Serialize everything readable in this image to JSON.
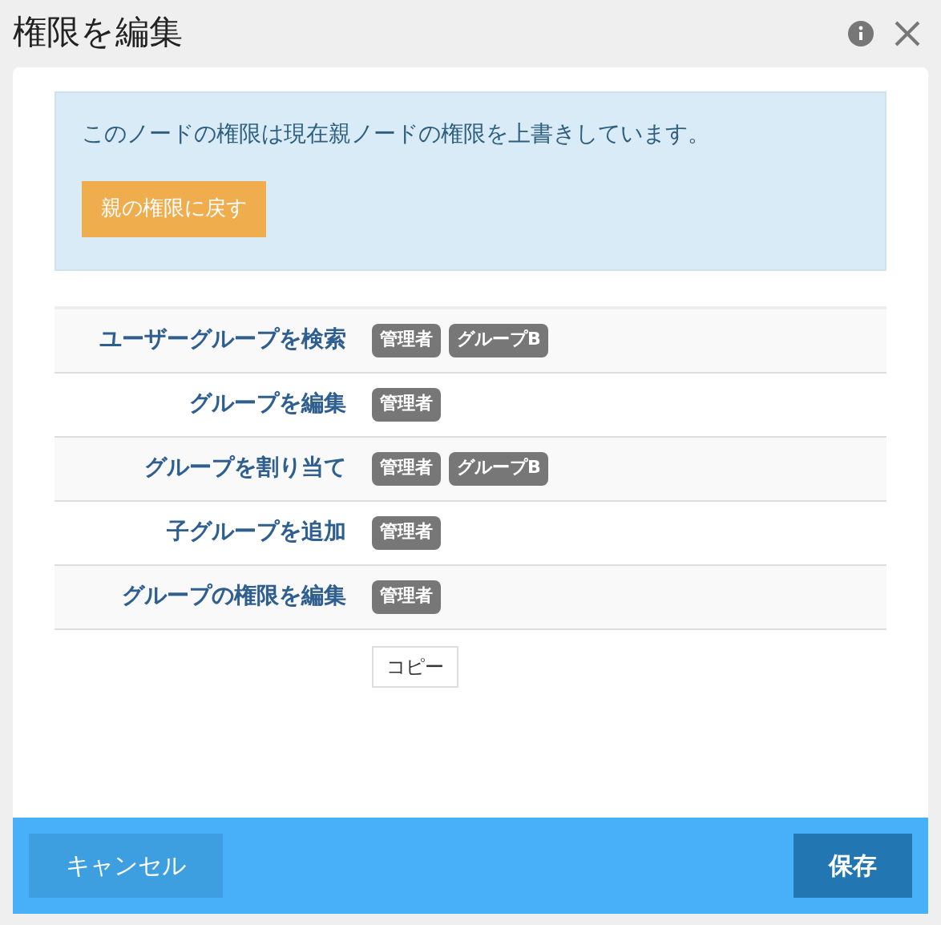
{
  "window": {
    "title": "権限を編集"
  },
  "notice": {
    "message": "このノードの権限は現在親ノードの権限を上書きしています。",
    "button": "親の権限に戻す"
  },
  "permissions": [
    {
      "name": "ユーザーグループを検索",
      "groups": [
        "管理者",
        "グループB"
      ]
    },
    {
      "name": "グループを編集",
      "groups": [
        "管理者"
      ]
    },
    {
      "name": "グループを割り当て",
      "groups": [
        "管理者",
        "グループB"
      ]
    },
    {
      "name": "子グループを追加",
      "groups": [
        "管理者"
      ]
    },
    {
      "name": "グループの権限を編集",
      "groups": [
        "管理者"
      ]
    }
  ],
  "copy_button": "コピー",
  "footer": {
    "cancel": "キャンセル",
    "save": "保存"
  }
}
